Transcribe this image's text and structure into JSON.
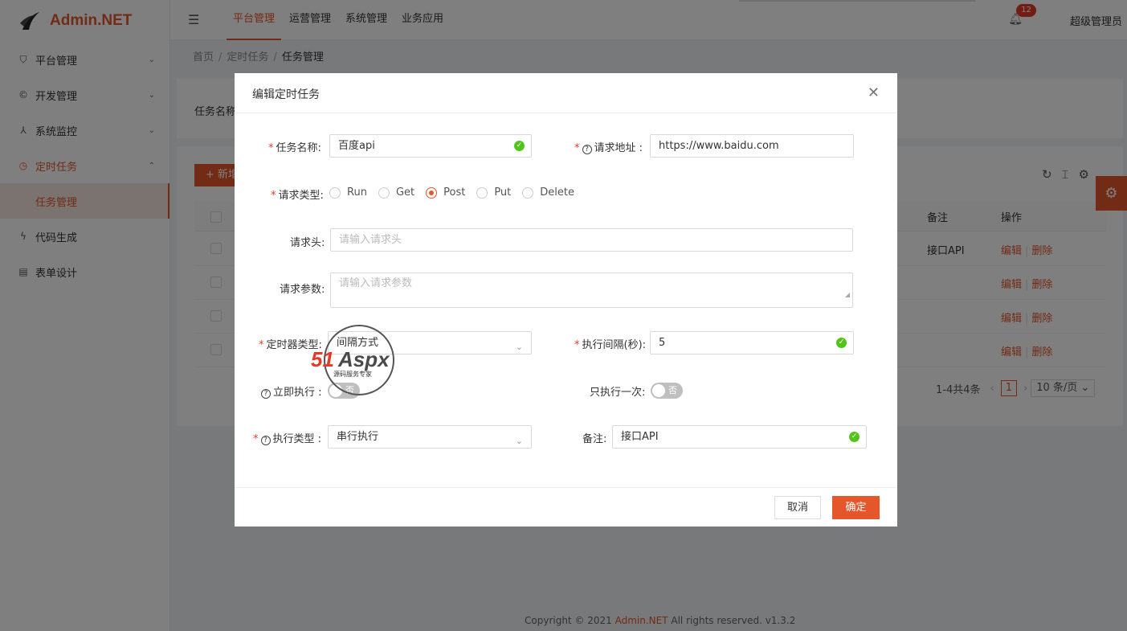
{
  "app": {
    "name": "Admin.NET"
  },
  "sidebar": {
    "items": [
      {
        "label": "平台管理",
        "icon": "shield-icon"
      },
      {
        "label": "开发管理",
        "icon": "copyright-icon"
      },
      {
        "label": "系统监控",
        "icon": "cluster-icon"
      },
      {
        "label": "定时任务",
        "icon": "clock-icon"
      },
      {
        "label": "任务管理",
        "icon": ""
      },
      {
        "label": "代码生成",
        "icon": "lightning-icon"
      },
      {
        "label": "表单设计",
        "icon": "form-icon"
      }
    ]
  },
  "header": {
    "nav": [
      "平台管理",
      "运营管理",
      "系统管理",
      "业务应用"
    ],
    "notification_count": "12",
    "user": "超级管理员"
  },
  "breadcrumb": [
    "首页",
    "定时任务",
    "任务管理"
  ],
  "background": {
    "filter_label": "任务名称",
    "add_label": "+ 新增",
    "columns": {
      "remark": "备注",
      "action": "操作"
    },
    "rows": [
      {
        "remark": "接口API"
      },
      {
        "remark": ""
      },
      {
        "remark": ""
      },
      {
        "remark": ""
      }
    ],
    "edit": "编辑",
    "delete": "删除",
    "pager": {
      "total": "1-4共4条",
      "page": "1",
      "size": "10 条/页"
    }
  },
  "footer": {
    "prefix": "Copyright © 2021 ",
    "brand": "Admin.NET",
    "suffix": " All rights reserved. v1.3.2"
  },
  "dialog": {
    "title": "编辑定时任务",
    "fields": {
      "task_name": {
        "label": "任务名称:",
        "value": "百度api"
      },
      "request_url": {
        "label": "请求地址 :",
        "value": "https://www.baidu.com"
      },
      "request_type": {
        "label": "请求类型:",
        "options": [
          "Run",
          "Get",
          "Post",
          "Put",
          "Delete"
        ],
        "selected": "Post"
      },
      "request_header": {
        "label": "请求头:",
        "placeholder": "请输入请求头"
      },
      "request_params": {
        "label": "请求参数:",
        "placeholder": "请输入请求参数"
      },
      "timer_type": {
        "label": "定时器类型:",
        "value": "间隔方式"
      },
      "interval": {
        "label": "执行间隔(秒):",
        "value": "5"
      },
      "immediate": {
        "label": "立即执行 :",
        "state": "否"
      },
      "run_once": {
        "label": "只执行一次:",
        "state": "否"
      },
      "exec_type": {
        "label": "执行类型 :",
        "value": "串行执行"
      },
      "remark": {
        "label": "备注:",
        "value": "接口API"
      }
    },
    "cancel": "取消",
    "ok": "确定"
  },
  "watermark": {
    "brand": "51Aspx",
    "tagline": "源码服务专家"
  },
  "colors": {
    "accent": "#e5572a",
    "success": "#52c41a",
    "danger": "#e5392a"
  }
}
